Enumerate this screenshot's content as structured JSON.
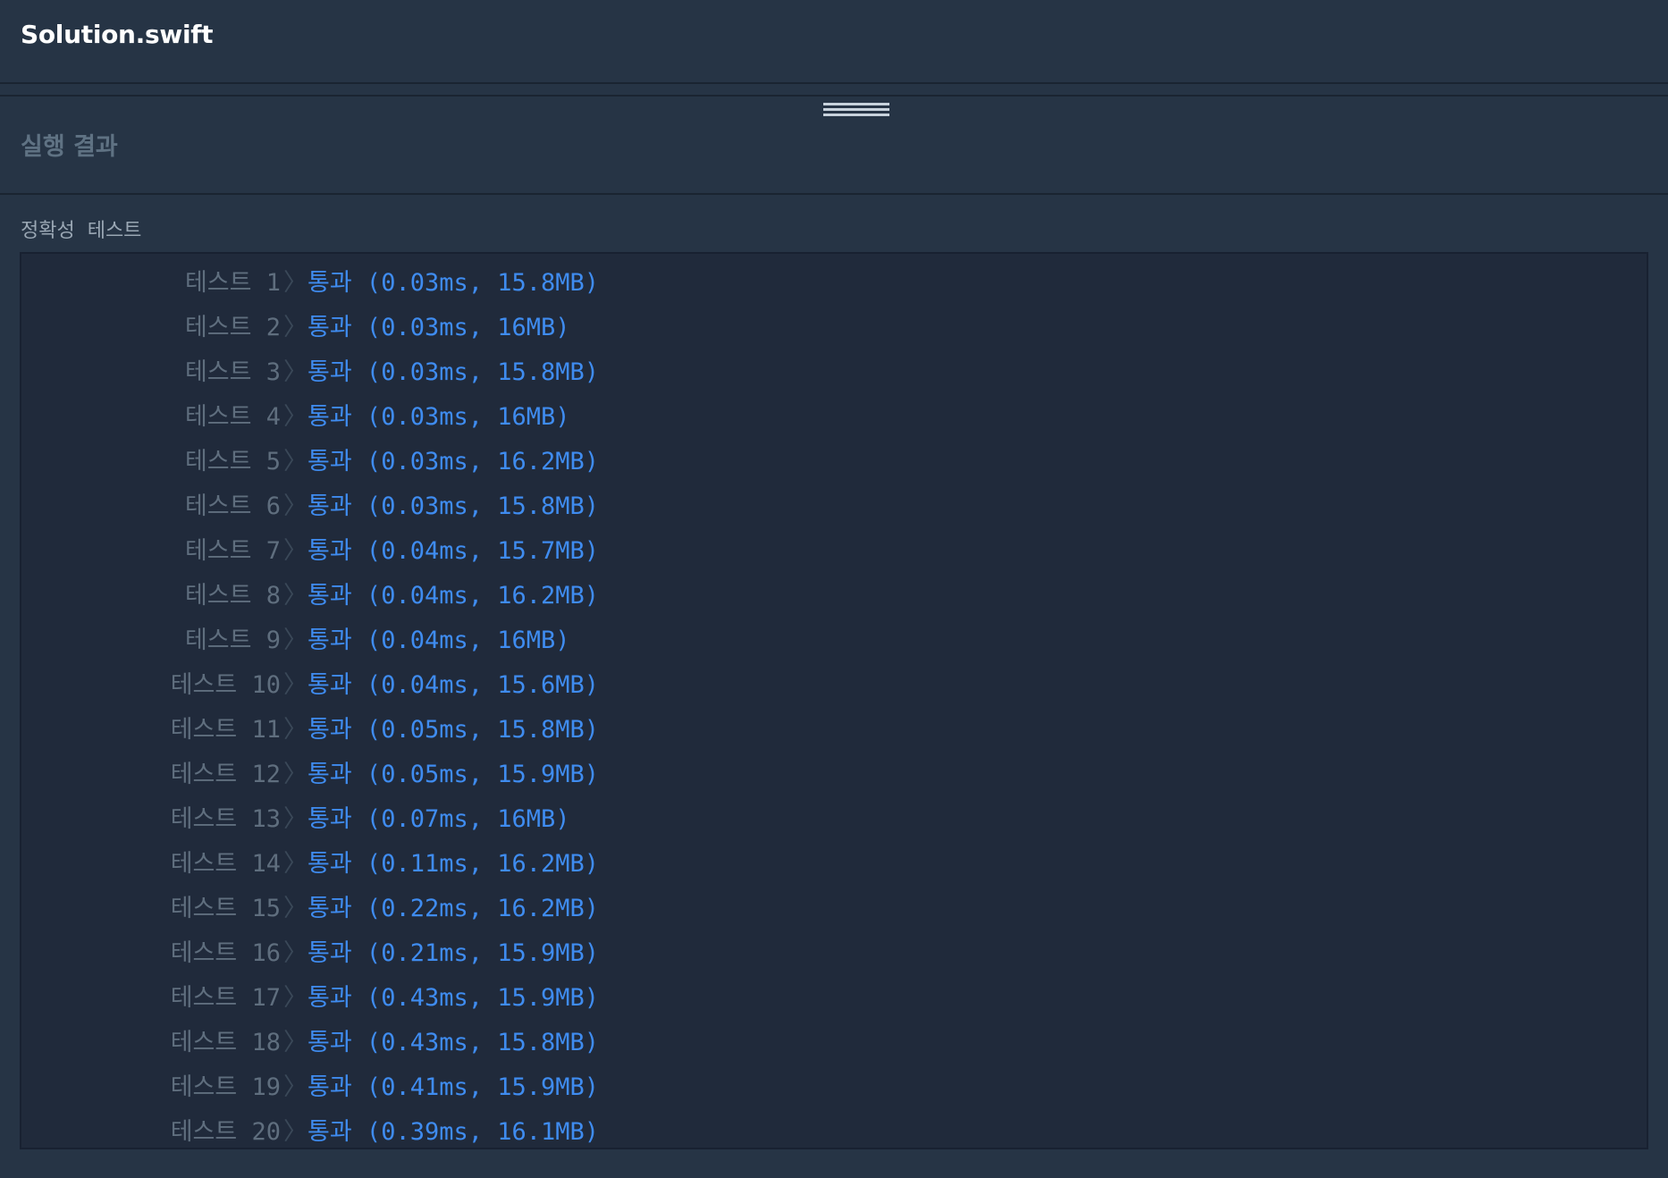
{
  "file": {
    "title": "Solution.swift"
  },
  "results": {
    "title": "실행 결과",
    "section_label": "정확성  테스트",
    "rows": [
      {
        "label": "테스트 1",
        "status": "통과 (0.03ms, 15.8MB)"
      },
      {
        "label": "테스트 2",
        "status": "통과 (0.03ms, 16MB)"
      },
      {
        "label": "테스트 3",
        "status": "통과 (0.03ms, 15.8MB)"
      },
      {
        "label": "테스트 4",
        "status": "통과 (0.03ms, 16MB)"
      },
      {
        "label": "테스트 5",
        "status": "통과 (0.03ms, 16.2MB)"
      },
      {
        "label": "테스트 6",
        "status": "통과 (0.03ms, 15.8MB)"
      },
      {
        "label": "테스트 7",
        "status": "통과 (0.04ms, 15.7MB)"
      },
      {
        "label": "테스트 8",
        "status": "통과 (0.04ms, 16.2MB)"
      },
      {
        "label": "테스트 9",
        "status": "통과 (0.04ms, 16MB)"
      },
      {
        "label": "테스트 10",
        "status": "통과 (0.04ms, 15.6MB)"
      },
      {
        "label": "테스트 11",
        "status": "통과 (0.05ms, 15.8MB)"
      },
      {
        "label": "테스트 12",
        "status": "통과 (0.05ms, 15.9MB)"
      },
      {
        "label": "테스트 13",
        "status": "통과 (0.07ms, 16MB)"
      },
      {
        "label": "테스트 14",
        "status": "통과 (0.11ms, 16.2MB)"
      },
      {
        "label": "테스트 15",
        "status": "통과 (0.22ms, 16.2MB)"
      },
      {
        "label": "테스트 16",
        "status": "통과 (0.21ms, 15.9MB)"
      },
      {
        "label": "테스트 17",
        "status": "통과 (0.43ms, 15.9MB)"
      },
      {
        "label": "테스트 18",
        "status": "통과 (0.43ms, 15.8MB)"
      },
      {
        "label": "테스트 19",
        "status": "통과 (0.41ms, 15.9MB)"
      },
      {
        "label": "테스트 20",
        "status": "통과 (0.39ms, 16.1MB)"
      }
    ],
    "chevron": "〉"
  },
  "colors": {
    "background": "#263445",
    "panel": "#202a3b",
    "pass": "#3f8cf0",
    "label": "#5f6e7e"
  },
  "icons": {
    "drag_handle": "drag-handle-icon",
    "row_chevron": "chevron-right-icon"
  }
}
